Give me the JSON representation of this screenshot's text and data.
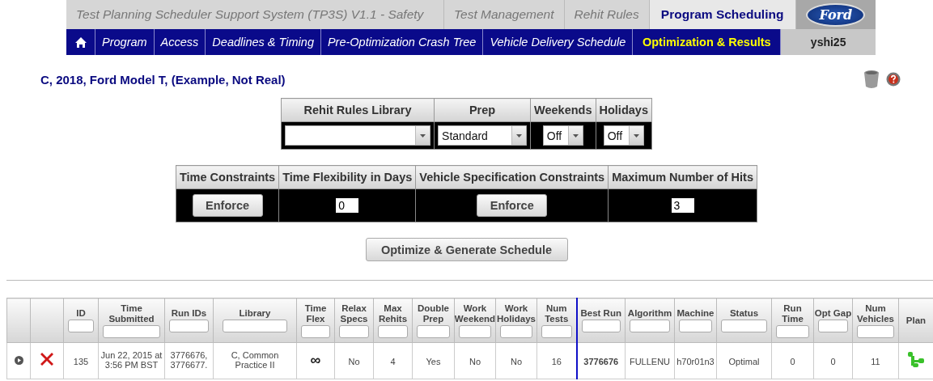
{
  "header": {
    "system_title": "Test Planning Scheduler Support System (TP3S) V1.1 - Safety",
    "tabs": [
      {
        "label": "Test Management",
        "selected": false
      },
      {
        "label": "Rehit Rules",
        "selected": false
      },
      {
        "label": "Program Scheduling",
        "selected": true
      }
    ],
    "logo": "Ford",
    "nav": [
      {
        "label": "Program",
        "selected": false
      },
      {
        "label": "Access",
        "selected": false
      },
      {
        "label": "Deadlines & Timing",
        "selected": false
      },
      {
        "label": "Pre-Optimization Crash Tree",
        "selected": false
      },
      {
        "label": "Vehicle Delivery Schedule",
        "selected": false
      },
      {
        "label": "Optimization & Results",
        "selected": true
      }
    ],
    "user": "yshi25"
  },
  "page_title": "C, 2018, Ford Model T, (Example, Not Real)",
  "settings": [
    {
      "label": "Rehit Rules Library",
      "kind": "select"
    },
    {
      "label": "Prep",
      "kind": "select",
      "value": "Standard"
    },
    {
      "label": "Weekends",
      "kind": "select",
      "value": "Off"
    },
    {
      "label": "Holidays",
      "kind": "select",
      "value": "Off"
    }
  ],
  "constraints": [
    {
      "label": "Time Constraints",
      "kind": "button",
      "value": "Enforce"
    },
    {
      "label": "Time Flexibility in Days",
      "kind": "input",
      "value": "0"
    },
    {
      "label": "Vehicle Specification Constraints",
      "kind": "button",
      "value": "Enforce"
    },
    {
      "label": "Maximum Number of Hits",
      "kind": "input",
      "value": "3"
    }
  ],
  "optimize_button": "Optimize & Generate Schedule",
  "results": {
    "columns": [
      {
        "filter": false,
        "split": false
      },
      {
        "filter": false,
        "split": false
      },
      {
        "label": "ID",
        "filter": true,
        "split": false
      },
      {
        "label": "Time Submitted",
        "filter": true,
        "split": false
      },
      {
        "label": "Run IDs",
        "filter": true,
        "split": false
      },
      {
        "label": "Library",
        "filter": true,
        "split": false
      },
      {
        "label": "Time Flex",
        "filter": true,
        "split": false
      },
      {
        "label": "Relax Specs",
        "filter": true,
        "split": false
      },
      {
        "label": "Max Rehits",
        "filter": true,
        "split": false
      },
      {
        "label": "Double Prep",
        "filter": true,
        "split": false
      },
      {
        "label": "Work Weekend",
        "filter": true,
        "split": false
      },
      {
        "label": "Work Holidays",
        "filter": true,
        "split": false
      },
      {
        "label": "Num Tests",
        "filter": true,
        "split": false
      },
      {
        "label": "Best Run",
        "filter": true,
        "split": true
      },
      {
        "label": "Algorithm",
        "filter": true,
        "split": false
      },
      {
        "label": "Machine",
        "filter": true,
        "split": false
      },
      {
        "label": "Status",
        "filter": true,
        "split": false
      },
      {
        "label": "Run Time",
        "filter": true,
        "split": false
      },
      {
        "label": "Opt Gap",
        "filter": true,
        "split": false
      },
      {
        "label": "Num Vehicles",
        "filter": true,
        "split": false
      },
      {
        "label": "Plan",
        "filter": false,
        "split": false
      }
    ],
    "rows": [
      {
        "cells": [
          {
            "kind": "expand"
          },
          {
            "kind": "delete"
          },
          {
            "kind": "text",
            "text": "135"
          },
          {
            "kind": "text",
            "text": "Jun 22, 2015 at 3:56 PM BST"
          },
          {
            "kind": "text",
            "text": "3776676, 3776677."
          },
          {
            "kind": "text",
            "text": "C, Common Practice II"
          },
          {
            "kind": "symbol",
            "text": "∞"
          },
          {
            "kind": "text",
            "text": "No"
          },
          {
            "kind": "text",
            "text": "4"
          },
          {
            "kind": "text",
            "text": "Yes"
          },
          {
            "kind": "text",
            "text": "No"
          },
          {
            "kind": "text",
            "text": "No"
          },
          {
            "kind": "text",
            "text": "16"
          },
          {
            "kind": "bold",
            "text": "3776676"
          },
          {
            "kind": "text",
            "text": "FULLENU"
          },
          {
            "kind": "text",
            "text": "h70r01n3"
          },
          {
            "kind": "text",
            "text": "Optimal"
          },
          {
            "kind": "text",
            "text": "0"
          },
          {
            "kind": "text",
            "text": "0"
          },
          {
            "kind": "text",
            "text": "11"
          },
          {
            "kind": "plan"
          }
        ]
      }
    ]
  }
}
